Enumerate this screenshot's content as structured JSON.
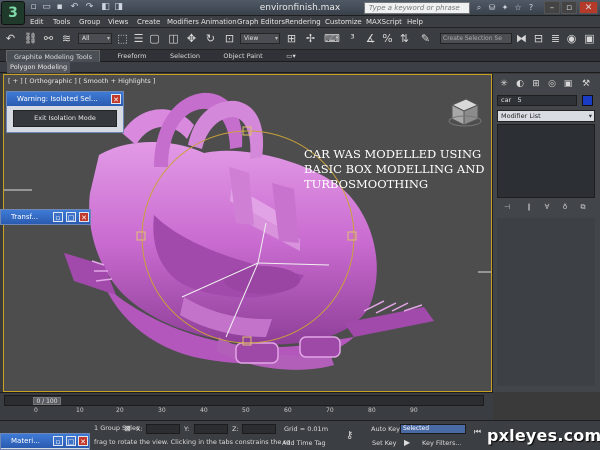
{
  "window": {
    "title": "environfinish.max",
    "search_placeholder": "Type a keyword or phrase",
    "logo_text": "3"
  },
  "menu": [
    "Edit",
    "Tools",
    "Group",
    "Views",
    "Create",
    "Modifiers",
    "Animation",
    "Graph Editors",
    "Rendering",
    "Customize",
    "MAXScript",
    "Help"
  ],
  "toolbar": {
    "filter_dropdown": "All",
    "refcoord_dropdown": "View",
    "selection_set_placeholder": "Create Selection Se"
  },
  "ribbon": {
    "tabs": [
      "Graphite Modeling Tools",
      "Freeform",
      "Selection",
      "Object Paint"
    ],
    "panel_label": "Polygon Modeling"
  },
  "viewport": {
    "label": "[ + ] [ Orthographic ] [ Smooth + Highlights ]",
    "annotation": "CAR WAS MODELLED USING BASIC BOX MODELLING AND TURBOSMOOTHING",
    "model_color": "#c96bd0",
    "border_color": "#c9a225"
  },
  "dialogs": {
    "warning_title": "Warning: Isolated Sel...",
    "exit_isolation_label": "Exit Isolation Mode",
    "transform_title": "Transf...",
    "material_title": "Materi..."
  },
  "command_panel": {
    "object_name": "car",
    "object_suffix": "5",
    "object_color": "#1a3cc4",
    "modifier_list": "Modifier List"
  },
  "timeline": {
    "frame_display": "0 / 100",
    "ticks": [
      "0",
      "10",
      "20",
      "30",
      "40",
      "50",
      "60",
      "70",
      "80",
      "90"
    ]
  },
  "status": {
    "selection_info": "1 Group Selec",
    "prompt": "frag to rotate the view. Clicking in the tabs constrains the ro",
    "x_label": "X:",
    "y_label": "Y:",
    "z_label": "Z:",
    "grid": "Grid = 0.01m",
    "add_time_tag": "Add Time Tag",
    "auto_key": "Auto Key",
    "set_key": "Set Key",
    "key_mode": "Selected",
    "key_filters": "Key Filters..."
  },
  "watermark": "pxleyes.com"
}
